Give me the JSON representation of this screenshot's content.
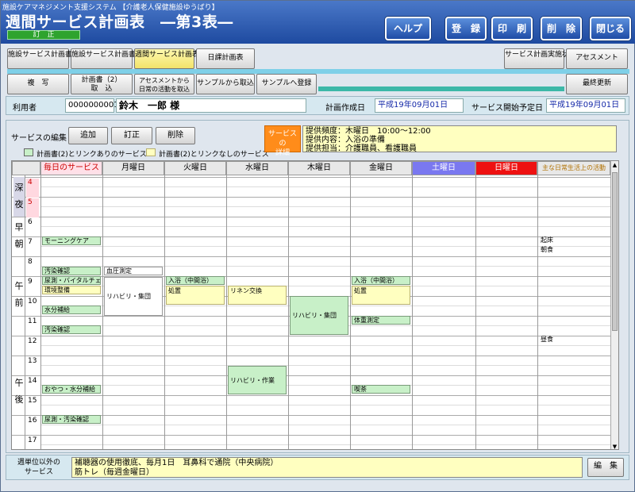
{
  "window": {
    "caption": "施設ケアマネジメント支援システム 【介護老人保健施設ゆうばり】",
    "title": "週間サービス計画表　―第3表―",
    "mode": "訂　正"
  },
  "header_buttons": {
    "help": "ヘルプ",
    "register": "登　録",
    "print": "印　刷",
    "delete": "削　除",
    "close": "閉じる"
  },
  "nav": {
    "plan1": "施設サービス計画書（1）",
    "plan2": "施設サービス計画書（2）",
    "weekly": "週間サービス計画表",
    "daily": "日課計画表",
    "status": "サービス計画実施状況",
    "assess": "アセスメント"
  },
  "actions": {
    "copy": "複　写",
    "import_plan2_l1": "計画書（2）",
    "import_plan2_l2": "取　込",
    "import_assess_l1": "アセスメントから",
    "import_assess_l2": "日常の活動を取込",
    "sample_import": "サンプルから取込",
    "sample_register": "サンプルへ登録",
    "latest_update": "最終更新"
  },
  "info": {
    "user_label": "利用者",
    "user_id": "0000000001",
    "user_name": "鈴木　一郎 様",
    "created_label": "計画作成日",
    "created_date": "平成19年09月01日",
    "start_label": "サービス開始予定日",
    "start_date": "平成19年09月01日"
  },
  "edit": {
    "label": "サービスの編集",
    "add": "追加",
    "modify": "訂正",
    "remove": "削除",
    "legend_linked": "計画書(2)とリンクありのサービス",
    "legend_unlinked": "計画書(2)とリンクなしのサービス"
  },
  "detail": {
    "label_l1": "サービスの",
    "label_l2": "詳細",
    "line1": "提供頻度：木曜日　10:00～12:00",
    "line2": "提供内容：入浴の準備",
    "line3": "提供担当：介護職員、看護職員"
  },
  "schedule": {
    "headers": {
      "daily": "毎日のサービス",
      "mon": "月曜日",
      "tue": "火曜日",
      "wed": "水曜日",
      "thu": "木曜日",
      "fri": "金曜日",
      "sat": "土曜日",
      "sun": "日曜日",
      "life": "主な日常生活上の活動"
    },
    "periods": {
      "late_night_1": "深",
      "late_night_2": "夜",
      "early_1": "早",
      "early_2": "朝",
      "am_1": "午",
      "am_2": "前",
      "pm_1": "午",
      "pm_2": "後"
    },
    "hours": [
      "4",
      "5",
      "6",
      "7",
      "8",
      "9",
      "10",
      "11",
      "12",
      "13",
      "14",
      "15",
      "16",
      "17"
    ],
    "daily_items": {
      "morning_care": "モーニングケア",
      "check_soil": "汚染確認",
      "urine_vital": "尿測・バイタルチェック",
      "environment": "環境整備",
      "hydration": "水分補給",
      "check_soil2": "汚染確認",
      "snack": "おやつ・水分補給",
      "urine_check": "尿測・汚染確認"
    },
    "mon": {
      "bp": "血圧測定",
      "rehab": "リハビリ・集団"
    },
    "tue": {
      "bath": "入浴（中間浴）",
      "treat": "処置"
    },
    "wed": {
      "linen": "リネン交換",
      "rehab_work": "リハビリ・作業"
    },
    "thu": {
      "rehab": "リハビリ・集団"
    },
    "fri": {
      "bath": "入浴（中間浴）",
      "treat": "処置",
      "weight": "体重測定",
      "cafe": "喫茶"
    },
    "life": {
      "wake": "起床",
      "breakfast": "朝食",
      "lunch": "昼食"
    }
  },
  "bottom": {
    "label_l1": "週単位以外の",
    "label_l2": "サービス",
    "line1": "補聴器の使用徹底、毎月1日　耳鼻科で通院（中央病院）",
    "line2": "筋トレ（毎週金曜日）",
    "edit": "編　集"
  }
}
